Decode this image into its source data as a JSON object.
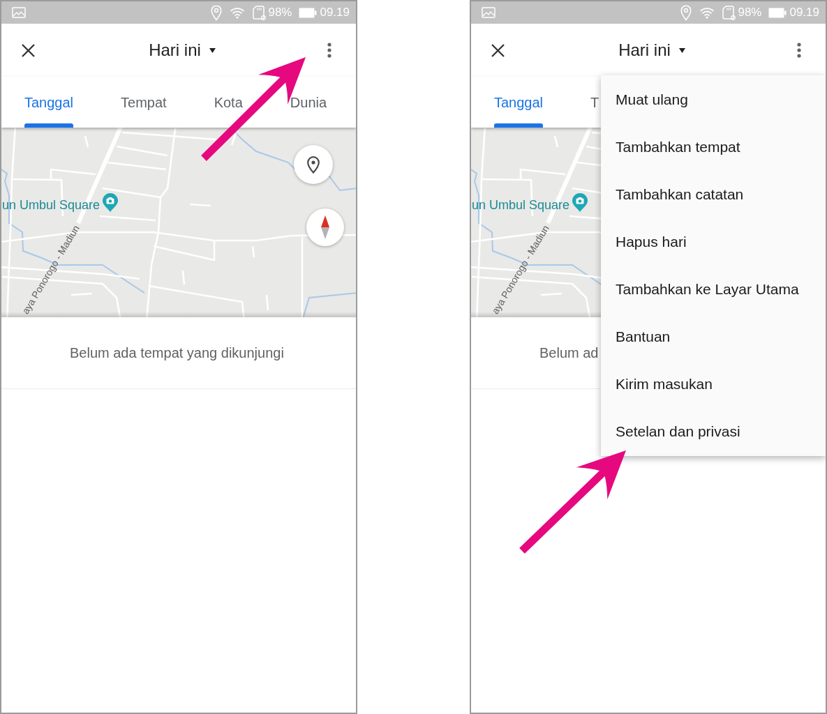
{
  "screens": [
    {
      "status_bar": {
        "battery_text": "98%",
        "time": "09.19"
      },
      "app_bar": {
        "title": "Hari ini"
      },
      "tabs": [
        {
          "label": "Tanggal",
          "selected": true
        },
        {
          "label": "Tempat",
          "selected": false
        },
        {
          "label": "Kota",
          "selected": false
        },
        {
          "label": "Dunia",
          "selected": false
        }
      ],
      "map": {
        "labels": [
          {
            "kind": "place",
            "text": "un Umbul Square"
          },
          {
            "kind": "road",
            "text": "aya Ponorogo - Madiun"
          }
        ],
        "buttons": [
          {
            "kind": "location"
          },
          {
            "kind": "compass"
          }
        ]
      },
      "empty_message": "Belum ada tempat yang dikunjungi",
      "annotation_arrow": true
    },
    {
      "status_bar": {
        "battery_text": "98%",
        "time": "09.19"
      },
      "app_bar": {
        "title": "Hari ini"
      },
      "tabs": [
        {
          "label": "Tanggal",
          "selected": true
        },
        {
          "label": "T",
          "selected": false
        }
      ],
      "map": {
        "labels": [
          {
            "kind": "place",
            "text": "un Umbul Square"
          },
          {
            "kind": "road",
            "text": "aya Ponorogo - Madiun"
          }
        ]
      },
      "empty_message": "Belum ad",
      "menu": {
        "items": [
          "Muat ulang",
          "Tambahkan tempat",
          "Tambahkan catatan",
          "Hapus hari",
          "Tambahkan ke Layar Utama",
          "Bantuan",
          "Kirim masukan",
          "Setelan dan privasi"
        ]
      },
      "annotation_arrow": true
    }
  ]
}
